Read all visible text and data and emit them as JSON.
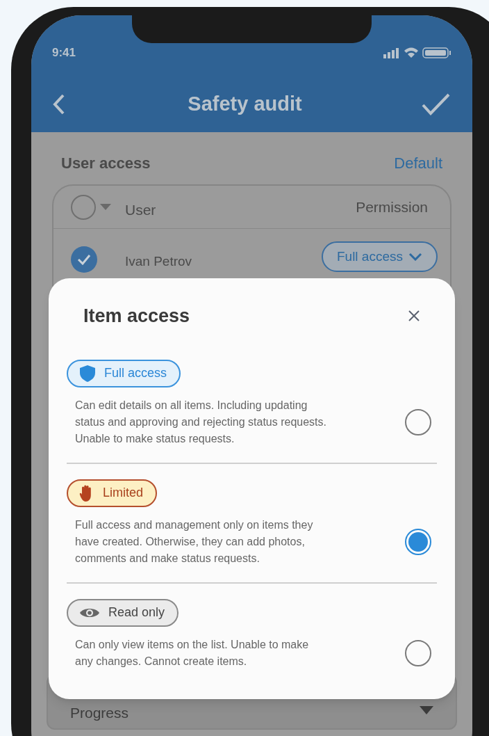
{
  "status_bar": {
    "time": "9:41"
  },
  "nav": {
    "title": "Safety audit"
  },
  "section": {
    "title": "User access",
    "action": "Default"
  },
  "table": {
    "header": {
      "checked": false,
      "user": "User",
      "permission": "Permission"
    },
    "rows": [
      {
        "name": "Ivan Petrov",
        "checked": true,
        "permission": "Full access"
      }
    ]
  },
  "progress": {
    "label": "Progress"
  },
  "dialog": {
    "title": "Item access",
    "options": [
      {
        "kind": "full",
        "label": "Full access",
        "description": "Can edit details on all items. Including updating status and approving and rejecting status requests. Unable to make status requests.",
        "selected": false
      },
      {
        "kind": "limited",
        "label": "Limited",
        "description": "Full access and management only on items they have created. Otherwise, they can add photos, comments and make status requests.",
        "selected": true
      },
      {
        "kind": "readonly",
        "label": "Read only",
        "description": "Can only view items on the list. Unable to make any changes. Cannot create items.",
        "selected": false
      }
    ]
  }
}
